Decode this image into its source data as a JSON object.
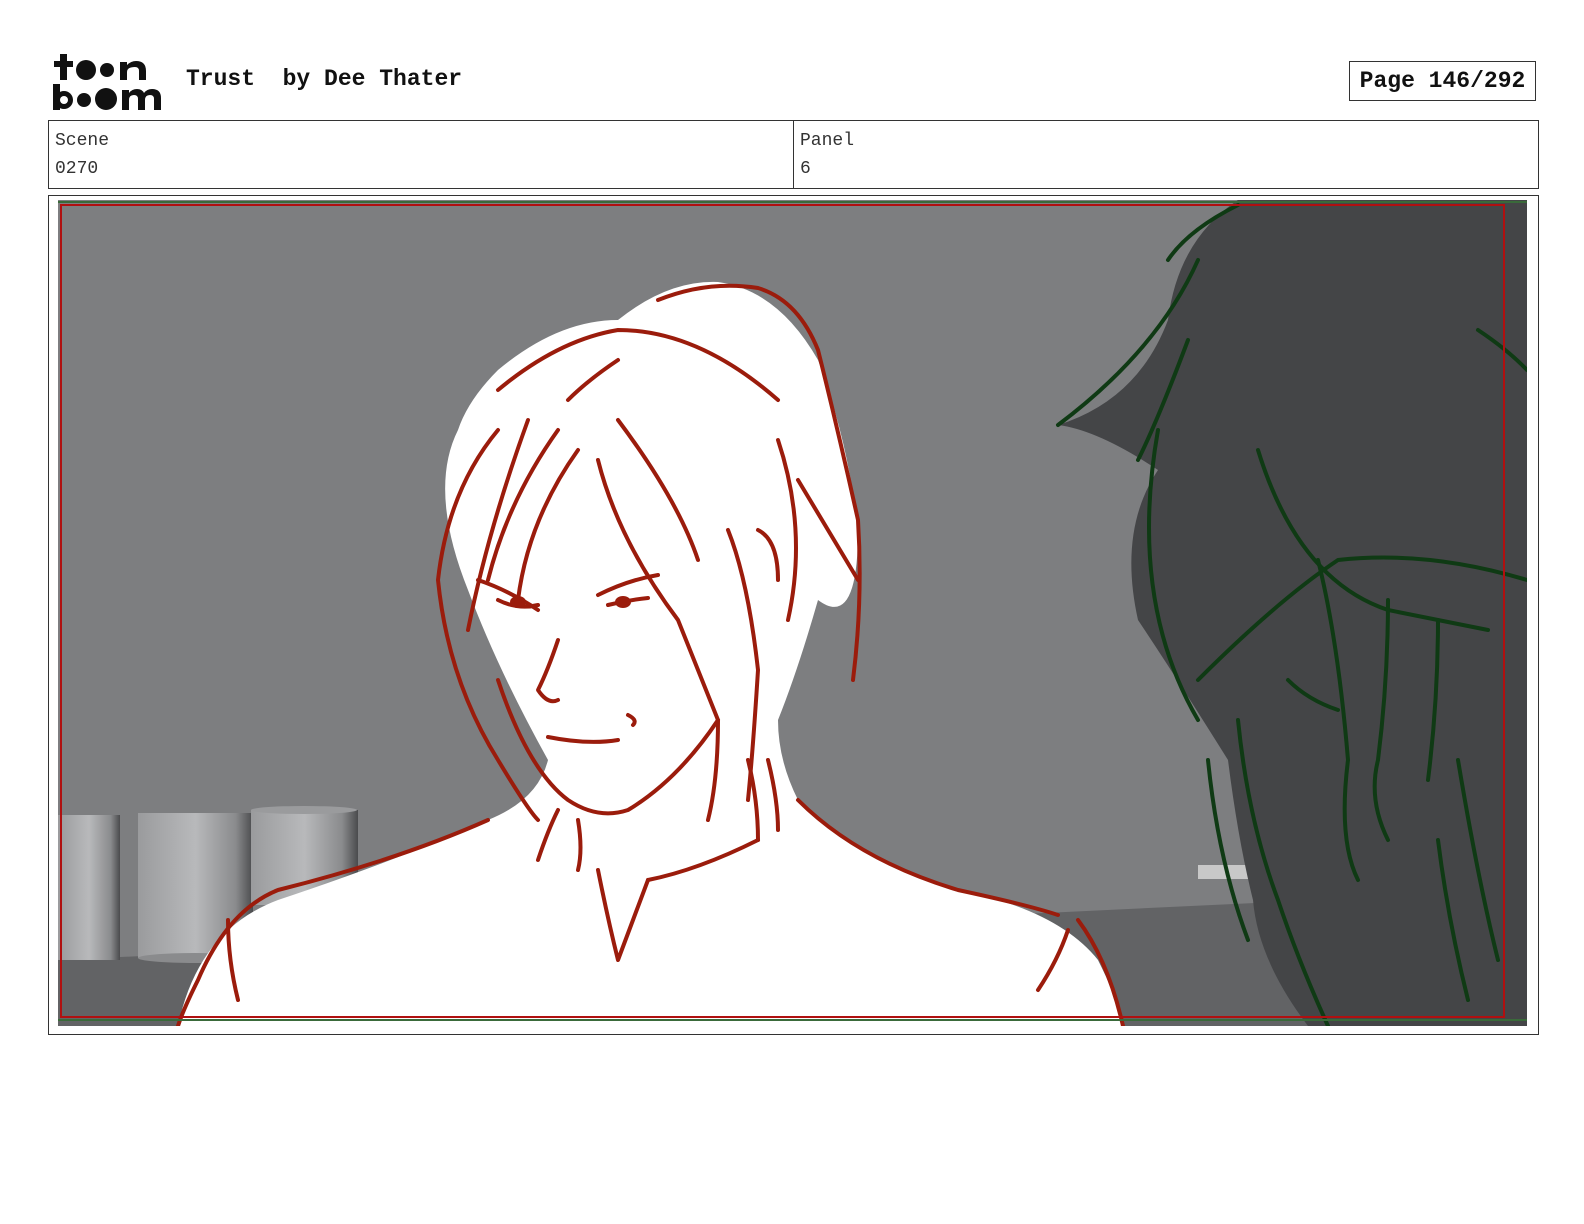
{
  "header": {
    "logo_text": "toon boom",
    "title": "Trust  by Dee Thater",
    "page": "Page 146/292"
  },
  "info": {
    "scene_label": "Scene",
    "scene_value": "0270",
    "panel_label": "Panel",
    "panel_value": "6"
  },
  "colors": {
    "sketch_red": "#9b1c0c",
    "sketch_green": "#0f3a14",
    "background_gray": "#7d7e80",
    "safe_frame": "#b01010"
  }
}
